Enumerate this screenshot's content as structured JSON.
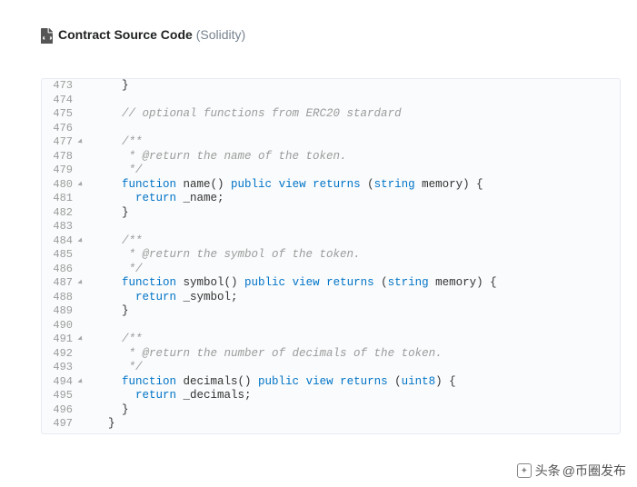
{
  "header": {
    "title_bold": "Contract Source Code",
    "title_light": "(Solidity)"
  },
  "code": {
    "lines": [
      {
        "num": 473,
        "fold": false,
        "indent": 2,
        "tokens": [
          {
            "t": "}"
          }
        ]
      },
      {
        "num": 474,
        "fold": false,
        "indent": 0,
        "tokens": []
      },
      {
        "num": 475,
        "fold": false,
        "indent": 2,
        "tokens": [
          {
            "t": "// optional functions from ERC20 stardard",
            "c": "com"
          }
        ]
      },
      {
        "num": 476,
        "fold": false,
        "indent": 0,
        "tokens": []
      },
      {
        "num": 477,
        "fold": true,
        "indent": 2,
        "tokens": [
          {
            "t": "/**",
            "c": "com"
          }
        ]
      },
      {
        "num": 478,
        "fold": false,
        "indent": 2,
        "tokens": [
          {
            "t": " * @return the name of the token.",
            "c": "com"
          }
        ]
      },
      {
        "num": 479,
        "fold": false,
        "indent": 2,
        "tokens": [
          {
            "t": " */",
            "c": "com"
          }
        ]
      },
      {
        "num": 480,
        "fold": true,
        "indent": 2,
        "tokens": [
          {
            "t": "function",
            "c": "kw"
          },
          {
            "t": " name() "
          },
          {
            "t": "public",
            "c": "kw"
          },
          {
            "t": " "
          },
          {
            "t": "view",
            "c": "kw"
          },
          {
            "t": " "
          },
          {
            "t": "returns",
            "c": "kw"
          },
          {
            "t": " ("
          },
          {
            "t": "string",
            "c": "typ"
          },
          {
            "t": " memory) {"
          }
        ]
      },
      {
        "num": 481,
        "fold": false,
        "indent": 3,
        "tokens": [
          {
            "t": "return",
            "c": "kw"
          },
          {
            "t": " _name;"
          }
        ]
      },
      {
        "num": 482,
        "fold": false,
        "indent": 2,
        "tokens": [
          {
            "t": "}"
          }
        ]
      },
      {
        "num": 483,
        "fold": false,
        "indent": 0,
        "tokens": []
      },
      {
        "num": 484,
        "fold": true,
        "indent": 2,
        "tokens": [
          {
            "t": "/**",
            "c": "com"
          }
        ]
      },
      {
        "num": 485,
        "fold": false,
        "indent": 2,
        "tokens": [
          {
            "t": " * @return the symbol of the token.",
            "c": "com"
          }
        ]
      },
      {
        "num": 486,
        "fold": false,
        "indent": 2,
        "tokens": [
          {
            "t": " */",
            "c": "com"
          }
        ]
      },
      {
        "num": 487,
        "fold": true,
        "indent": 2,
        "tokens": [
          {
            "t": "function",
            "c": "kw"
          },
          {
            "t": " symbol() "
          },
          {
            "t": "public",
            "c": "kw"
          },
          {
            "t": " "
          },
          {
            "t": "view",
            "c": "kw"
          },
          {
            "t": " "
          },
          {
            "t": "returns",
            "c": "kw"
          },
          {
            "t": " ("
          },
          {
            "t": "string",
            "c": "typ"
          },
          {
            "t": " memory) {"
          }
        ]
      },
      {
        "num": 488,
        "fold": false,
        "indent": 3,
        "tokens": [
          {
            "t": "return",
            "c": "kw"
          },
          {
            "t": " _symbol;"
          }
        ]
      },
      {
        "num": 489,
        "fold": false,
        "indent": 2,
        "tokens": [
          {
            "t": "}"
          }
        ]
      },
      {
        "num": 490,
        "fold": false,
        "indent": 0,
        "tokens": []
      },
      {
        "num": 491,
        "fold": true,
        "indent": 2,
        "tokens": [
          {
            "t": "/**",
            "c": "com"
          }
        ]
      },
      {
        "num": 492,
        "fold": false,
        "indent": 2,
        "tokens": [
          {
            "t": " * @return the number of decimals of the token.",
            "c": "com"
          }
        ]
      },
      {
        "num": 493,
        "fold": false,
        "indent": 2,
        "tokens": [
          {
            "t": " */",
            "c": "com"
          }
        ]
      },
      {
        "num": 494,
        "fold": true,
        "indent": 2,
        "tokens": [
          {
            "t": "function",
            "c": "kw"
          },
          {
            "t": " decimals() "
          },
          {
            "t": "public",
            "c": "kw"
          },
          {
            "t": " "
          },
          {
            "t": "view",
            "c": "kw"
          },
          {
            "t": " "
          },
          {
            "t": "returns",
            "c": "kw"
          },
          {
            "t": " ("
          },
          {
            "t": "uint8",
            "c": "typ"
          },
          {
            "t": ") {"
          }
        ]
      },
      {
        "num": 495,
        "fold": false,
        "indent": 3,
        "tokens": [
          {
            "t": "return",
            "c": "kw"
          },
          {
            "t": " _decimals;"
          }
        ]
      },
      {
        "num": 496,
        "fold": false,
        "indent": 2,
        "tokens": [
          {
            "t": "}"
          }
        ]
      },
      {
        "num": 497,
        "fold": false,
        "indent": 1,
        "tokens": [
          {
            "t": "}"
          }
        ]
      }
    ]
  },
  "watermark": {
    "prefix": "头条",
    "handle": "@币圈发布"
  }
}
